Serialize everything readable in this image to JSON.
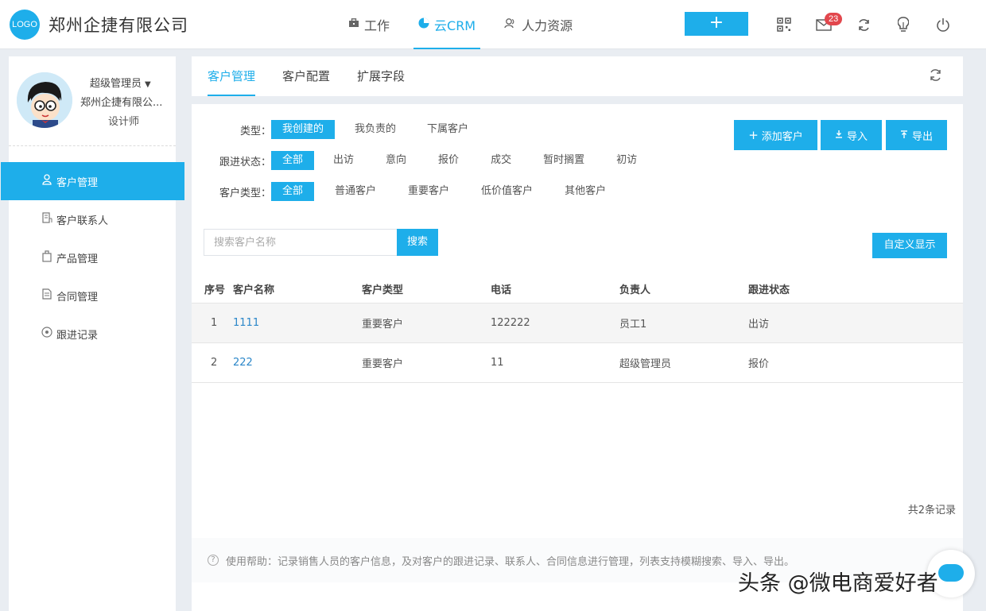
{
  "header": {
    "logo_text": "LOGO",
    "company": "郑州企捷有限公司",
    "nav": [
      {
        "label": "工作",
        "icon": "briefcase-icon"
      },
      {
        "label": "云CRM",
        "icon": "pie-chart-icon",
        "active": true
      },
      {
        "label": "人力资源",
        "icon": "users-icon"
      }
    ],
    "add_label": "+",
    "mail_badge": "23",
    "tools": [
      "qrcode-icon",
      "mail-icon",
      "refresh-icon",
      "lightbulb-icon",
      "power-icon"
    ]
  },
  "user": {
    "name": "超级管理员",
    "company": "郑州企捷有限公...",
    "role": "设计师"
  },
  "sidebar": {
    "items": [
      {
        "label": "客户管理",
        "icon": "user-icon",
        "active": true
      },
      {
        "label": "客户联系人",
        "icon": "building-icon"
      },
      {
        "label": "产品管理",
        "icon": "package-icon"
      },
      {
        "label": "合同管理",
        "icon": "document-icon"
      },
      {
        "label": "跟进记录",
        "icon": "target-icon"
      }
    ]
  },
  "tabs": [
    {
      "label": "客户管理",
      "active": true
    },
    {
      "label": "客户配置"
    },
    {
      "label": "扩展字段"
    }
  ],
  "filters": {
    "type": {
      "label": "类型：",
      "options": [
        "我创建的",
        "我负责的",
        "下属客户"
      ],
      "selected": "我创建的"
    },
    "status": {
      "label": "跟进状态：",
      "options": [
        "全部",
        "出访",
        "意向",
        "报价",
        "成交",
        "暂时搁置",
        "初访"
      ],
      "selected": "全部"
    },
    "customer_type": {
      "label": "客户类型：",
      "options": [
        "全部",
        "普通客户",
        "重要客户",
        "低价值客户",
        "其他客户"
      ],
      "selected": "全部"
    }
  },
  "actions": {
    "add": "添加客户",
    "import": "导入",
    "export": "导出"
  },
  "search": {
    "placeholder": "搜索客户名称",
    "button": "搜索"
  },
  "custom_display": "自定义显示",
  "table": {
    "headers": [
      "序号",
      "客户名称",
      "客户类型",
      "电话",
      "负责人",
      "跟进状态"
    ],
    "rows": [
      [
        "1",
        "1111",
        "重要客户",
        "122222",
        "员工1",
        "出访"
      ],
      [
        "2",
        "222",
        "重要客户",
        "11",
        "超级管理员",
        "报价"
      ]
    ]
  },
  "total": "共2条记录",
  "help": "使用帮助：记录销售人员的客户信息，及对客户的跟进记录、联系人、合同信息进行管理，列表支持模糊搜索、导入、导出。",
  "watermark": "头条 @微电商爱好者",
  "colors": {
    "accent": "#1eaeea",
    "badge": "#e2474d",
    "link": "#2b87c9"
  }
}
